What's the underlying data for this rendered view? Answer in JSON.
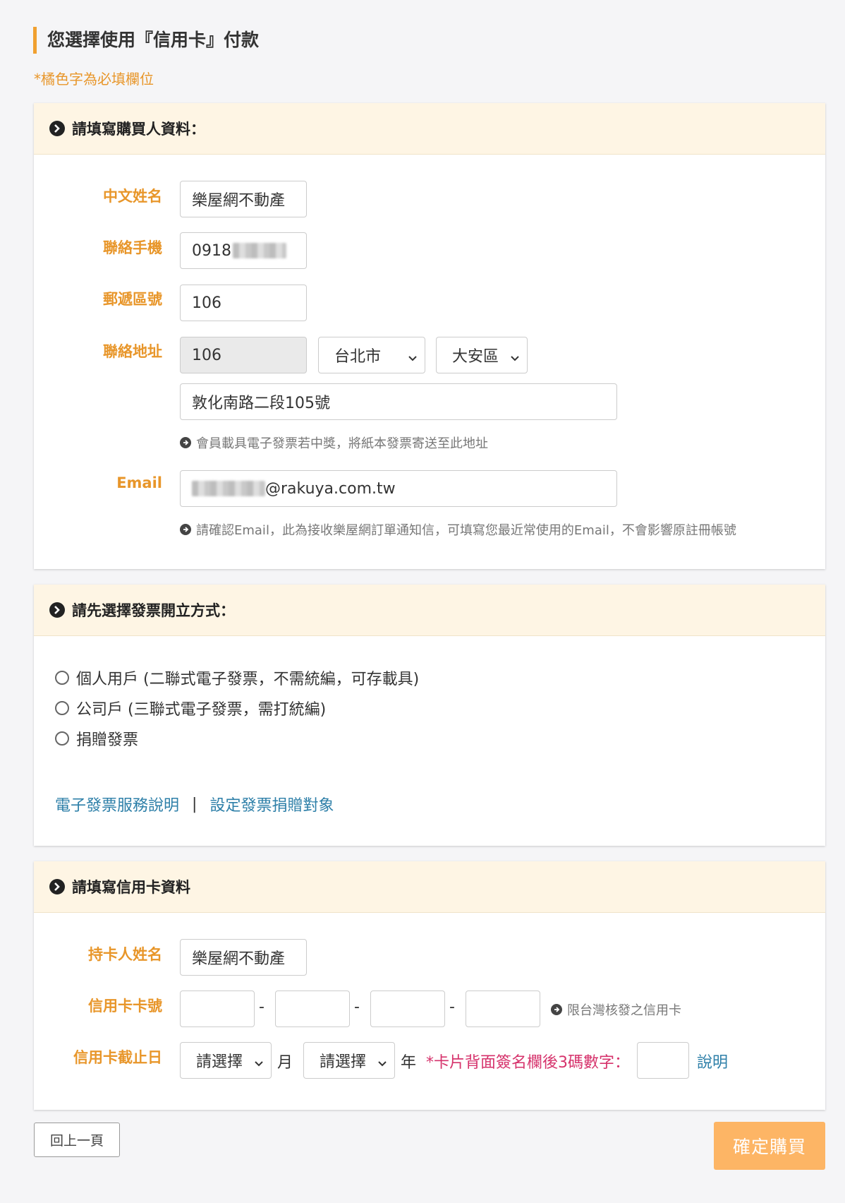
{
  "page": {
    "title": "您選擇使用『信用卡』付款",
    "required_note": "*橘色字為必填欄位"
  },
  "buyer": {
    "heading": "請填寫購買人資料：",
    "name_label": "中文姓名",
    "name_value": "樂屋網不動產",
    "phone_label": "聯絡手機",
    "phone_value_prefix": "0918",
    "postal_label": "郵遞區號",
    "postal_value": "106",
    "address_label": "聯絡地址",
    "address_postal": "106",
    "city": "台北市",
    "district": "大安區",
    "street": "敦化南路二段105號",
    "address_hint": "會員載具電子發票若中獎，將紙本發票寄送至此地址",
    "email_label": "Email",
    "email_value_suffix": "@rakuya.com.tw",
    "email_hint": "請確認Email，此為接收樂屋網訂單通知信，可填寫您最近常使用的Email，不會影響原註冊帳號"
  },
  "invoice": {
    "heading": "請先選擇發票開立方式：",
    "options": [
      "個人用戶 (二聯式電子發票，不需統編，可存載具)",
      "公司戶 (三聯式電子發票，需打統編)",
      "捐贈發票"
    ],
    "link_service": "電子發票服務說明",
    "separator": "|",
    "link_donate": "設定發票捐贈對象"
  },
  "card": {
    "heading": "請填寫信用卡資料",
    "holder_label": "持卡人姓名",
    "holder_value": "樂屋網不動產",
    "number_label": "信用卡卡號",
    "dash": "-",
    "number_hint": "限台灣核發之信用卡",
    "expiry_label": "信用卡截止日",
    "month_placeholder": "請選擇",
    "month_unit": "月",
    "year_placeholder": "請選擇",
    "year_unit": "年",
    "cvv_label": "*卡片背面簽名欄後3碼數字：",
    "cvv_help": "說明"
  },
  "actions": {
    "back": "回上一頁",
    "confirm": "確定購買"
  },
  "colors": {
    "accent": "#e8962a",
    "header_bg": "#fef5e4",
    "link": "#2d7fa8",
    "cvv": "#d6336c",
    "confirm_bg": "#fdb565"
  }
}
